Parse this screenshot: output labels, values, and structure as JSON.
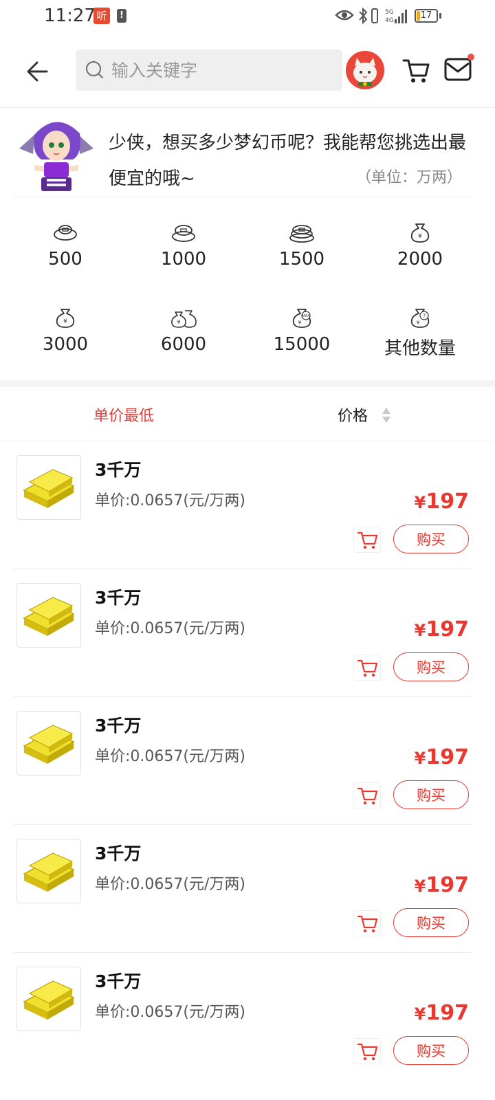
{
  "status_bar": {
    "time": "11:27",
    "notif_glyph": "听",
    "battery_level": "17",
    "battery_fraction": 0.17
  },
  "search": {
    "placeholder": "输入关键字"
  },
  "promo": {
    "message": "少侠，想买多少梦幻币呢？我能帮您挑选出最便宜的哦~",
    "unit": "（单位：万两）"
  },
  "amounts": [
    {
      "label": "500",
      "icon": "coins-small-icon"
    },
    {
      "label": "1000",
      "icon": "coins-stack-icon"
    },
    {
      "label": "1500",
      "icon": "coins-pile-icon"
    },
    {
      "label": "2000",
      "icon": "money-bag-icon"
    },
    {
      "label": "3000",
      "icon": "money-bag-icon"
    },
    {
      "label": "6000",
      "icon": "money-bags-icon"
    },
    {
      "label": "15000",
      "icon": "money-bag-max-icon"
    },
    {
      "label": "其他数量",
      "icon": "money-bag-question-icon"
    }
  ],
  "sort": {
    "lowest_label": "单价最低",
    "price_label": "价格"
  },
  "products": [
    {
      "title": "3千万",
      "unit_price": "单价:0.0657(元/万两)",
      "currency": "¥",
      "price": "197",
      "buy_label": "购买"
    },
    {
      "title": "3千万",
      "unit_price": "单价:0.0657(元/万两)",
      "currency": "¥",
      "price": "197",
      "buy_label": "购买"
    },
    {
      "title": "3千万",
      "unit_price": "单价:0.0657(元/万两)",
      "currency": "¥",
      "price": "197",
      "buy_label": "购买"
    },
    {
      "title": "3千万",
      "unit_price": "单价:0.0657(元/万两)",
      "currency": "¥",
      "price": "197",
      "buy_label": "购买"
    },
    {
      "title": "3千万",
      "unit_price": "单价:0.0657(元/万两)",
      "currency": "¥",
      "price": "197",
      "buy_label": "购买"
    }
  ],
  "colors": {
    "accent": "#e8382f",
    "sort_active": "#e0413c",
    "battery": "#f2a71b"
  }
}
